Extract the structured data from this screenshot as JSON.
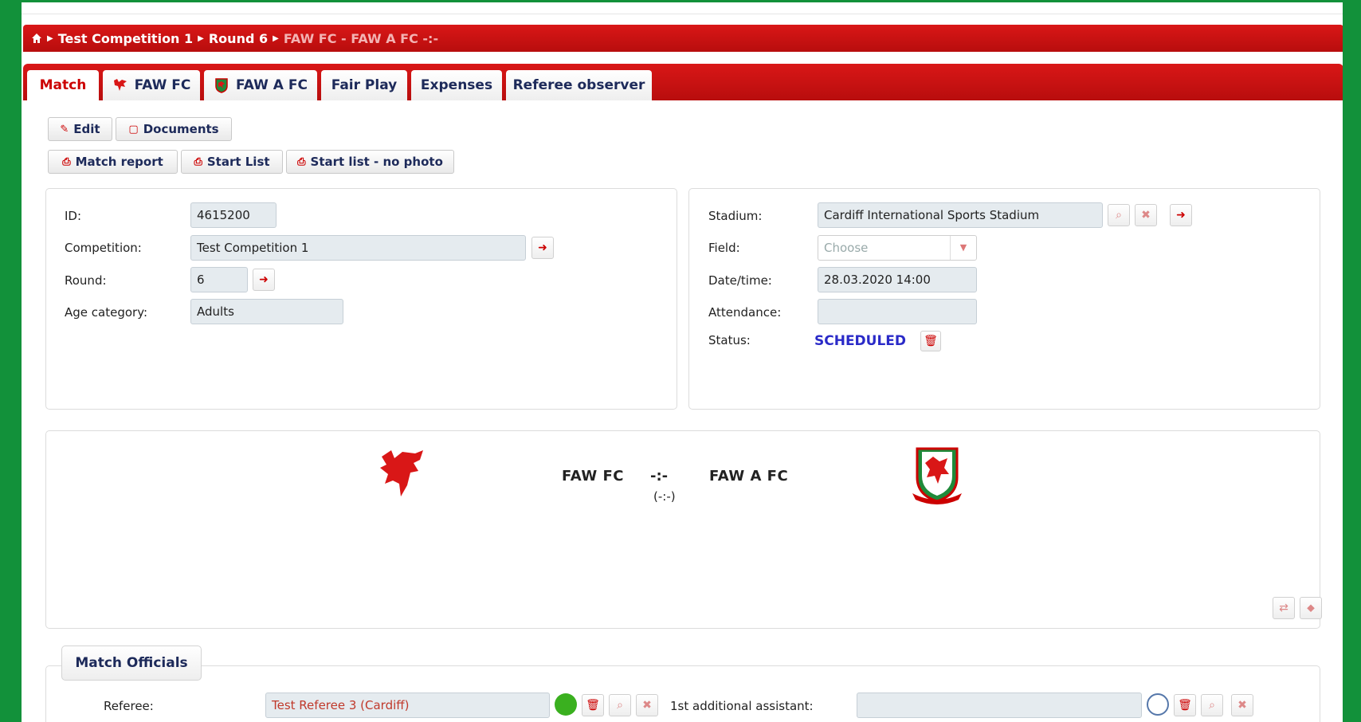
{
  "breadcrumb": {
    "items": [
      "Test Competition 1",
      "Round 6"
    ],
    "current": "FAW FC - FAW A FC -:-"
  },
  "tabs": [
    {
      "label": "Match",
      "active": true
    },
    {
      "label": "FAW FC"
    },
    {
      "label": "FAW A FC"
    },
    {
      "label": "Fair Play"
    },
    {
      "label": "Expenses"
    },
    {
      "label": "Referee observer"
    }
  ],
  "actions": {
    "edit": "Edit",
    "documents": "Documents",
    "match_report": "Match report",
    "start_list": "Start List",
    "start_list_no_photo": "Start list - no photo"
  },
  "info": {
    "id_label": "ID:",
    "id_value": "4615200",
    "competition_label": "Competition:",
    "competition_value": "Test Competition 1",
    "round_label": "Round:",
    "round_value": "6",
    "age_label": "Age category:",
    "age_value": "Adults"
  },
  "venue": {
    "stadium_label": "Stadium:",
    "stadium_value": "Cardiff International Sports Stadium",
    "field_label": "Field:",
    "field_placeholder": "Choose",
    "datetime_label": "Date/time:",
    "datetime_value": "28.03.2020 14:00",
    "attendance_label": "Attendance:",
    "attendance_value": "",
    "status_label": "Status:",
    "status_value": "SCHEDULED"
  },
  "match": {
    "home": "FAW FC",
    "away": "FAW A FC",
    "score": "-:-",
    "halftime": "(-:-)"
  },
  "officials": {
    "title": "Match Officials",
    "referee_label": "Referee:",
    "referee_value": "Test Referee 3 (Cardiff)",
    "assistant_label": "1st additional assistant:",
    "assistant_value": ""
  },
  "colors": {
    "accent": "#c00000",
    "status": "#2a2ac8",
    "frame": "#12913a",
    "confirmed": "#3ab01f"
  }
}
